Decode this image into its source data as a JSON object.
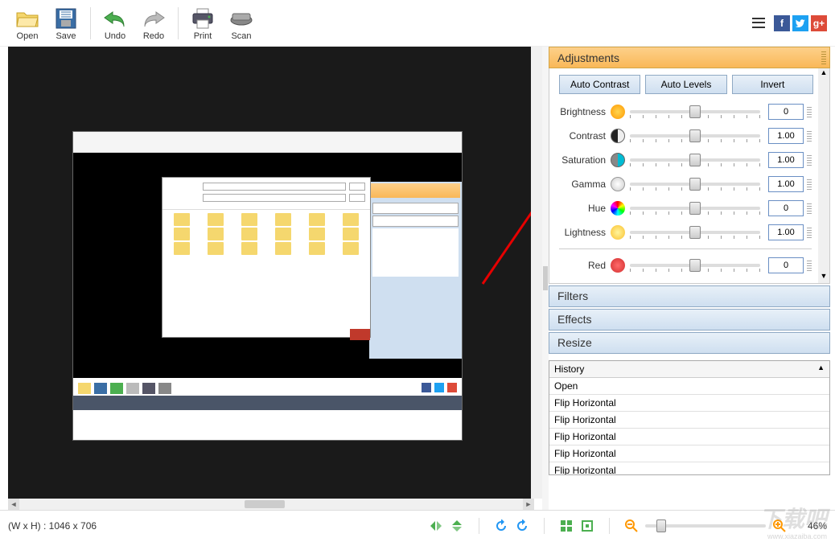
{
  "toolbar": {
    "open": "Open",
    "save": "Save",
    "undo": "Undo",
    "redo": "Redo",
    "print": "Print",
    "scan": "Scan"
  },
  "adjustments": {
    "title": "Adjustments",
    "auto_contrast": "Auto Contrast",
    "auto_levels": "Auto Levels",
    "invert": "Invert",
    "brightness": {
      "label": "Brightness",
      "value": "0",
      "pos": 50
    },
    "contrast": {
      "label": "Contrast",
      "value": "1.00",
      "pos": 50
    },
    "saturation": {
      "label": "Saturation",
      "value": "1.00",
      "pos": 50
    },
    "gamma": {
      "label": "Gamma",
      "value": "1.00",
      "pos": 50
    },
    "hue": {
      "label": "Hue",
      "value": "0",
      "pos": 50
    },
    "lightness": {
      "label": "Lightness",
      "value": "1.00",
      "pos": 50
    },
    "red": {
      "label": "Red",
      "value": "0",
      "pos": 50
    }
  },
  "filters": {
    "title": "Filters"
  },
  "effects": {
    "title": "Effects"
  },
  "resize": {
    "title": "Resize"
  },
  "history": {
    "title": "History",
    "items": [
      "Open",
      "Flip Horizontal",
      "Flip Horizontal",
      "Flip Horizontal",
      "Flip Horizontal",
      "Flip Horizontal"
    ]
  },
  "status": {
    "dimensions": "(W x H) : 1046 x 706",
    "zoom": "46%"
  },
  "social": {
    "fb": "f",
    "tw": "t",
    "gp": "g+"
  }
}
